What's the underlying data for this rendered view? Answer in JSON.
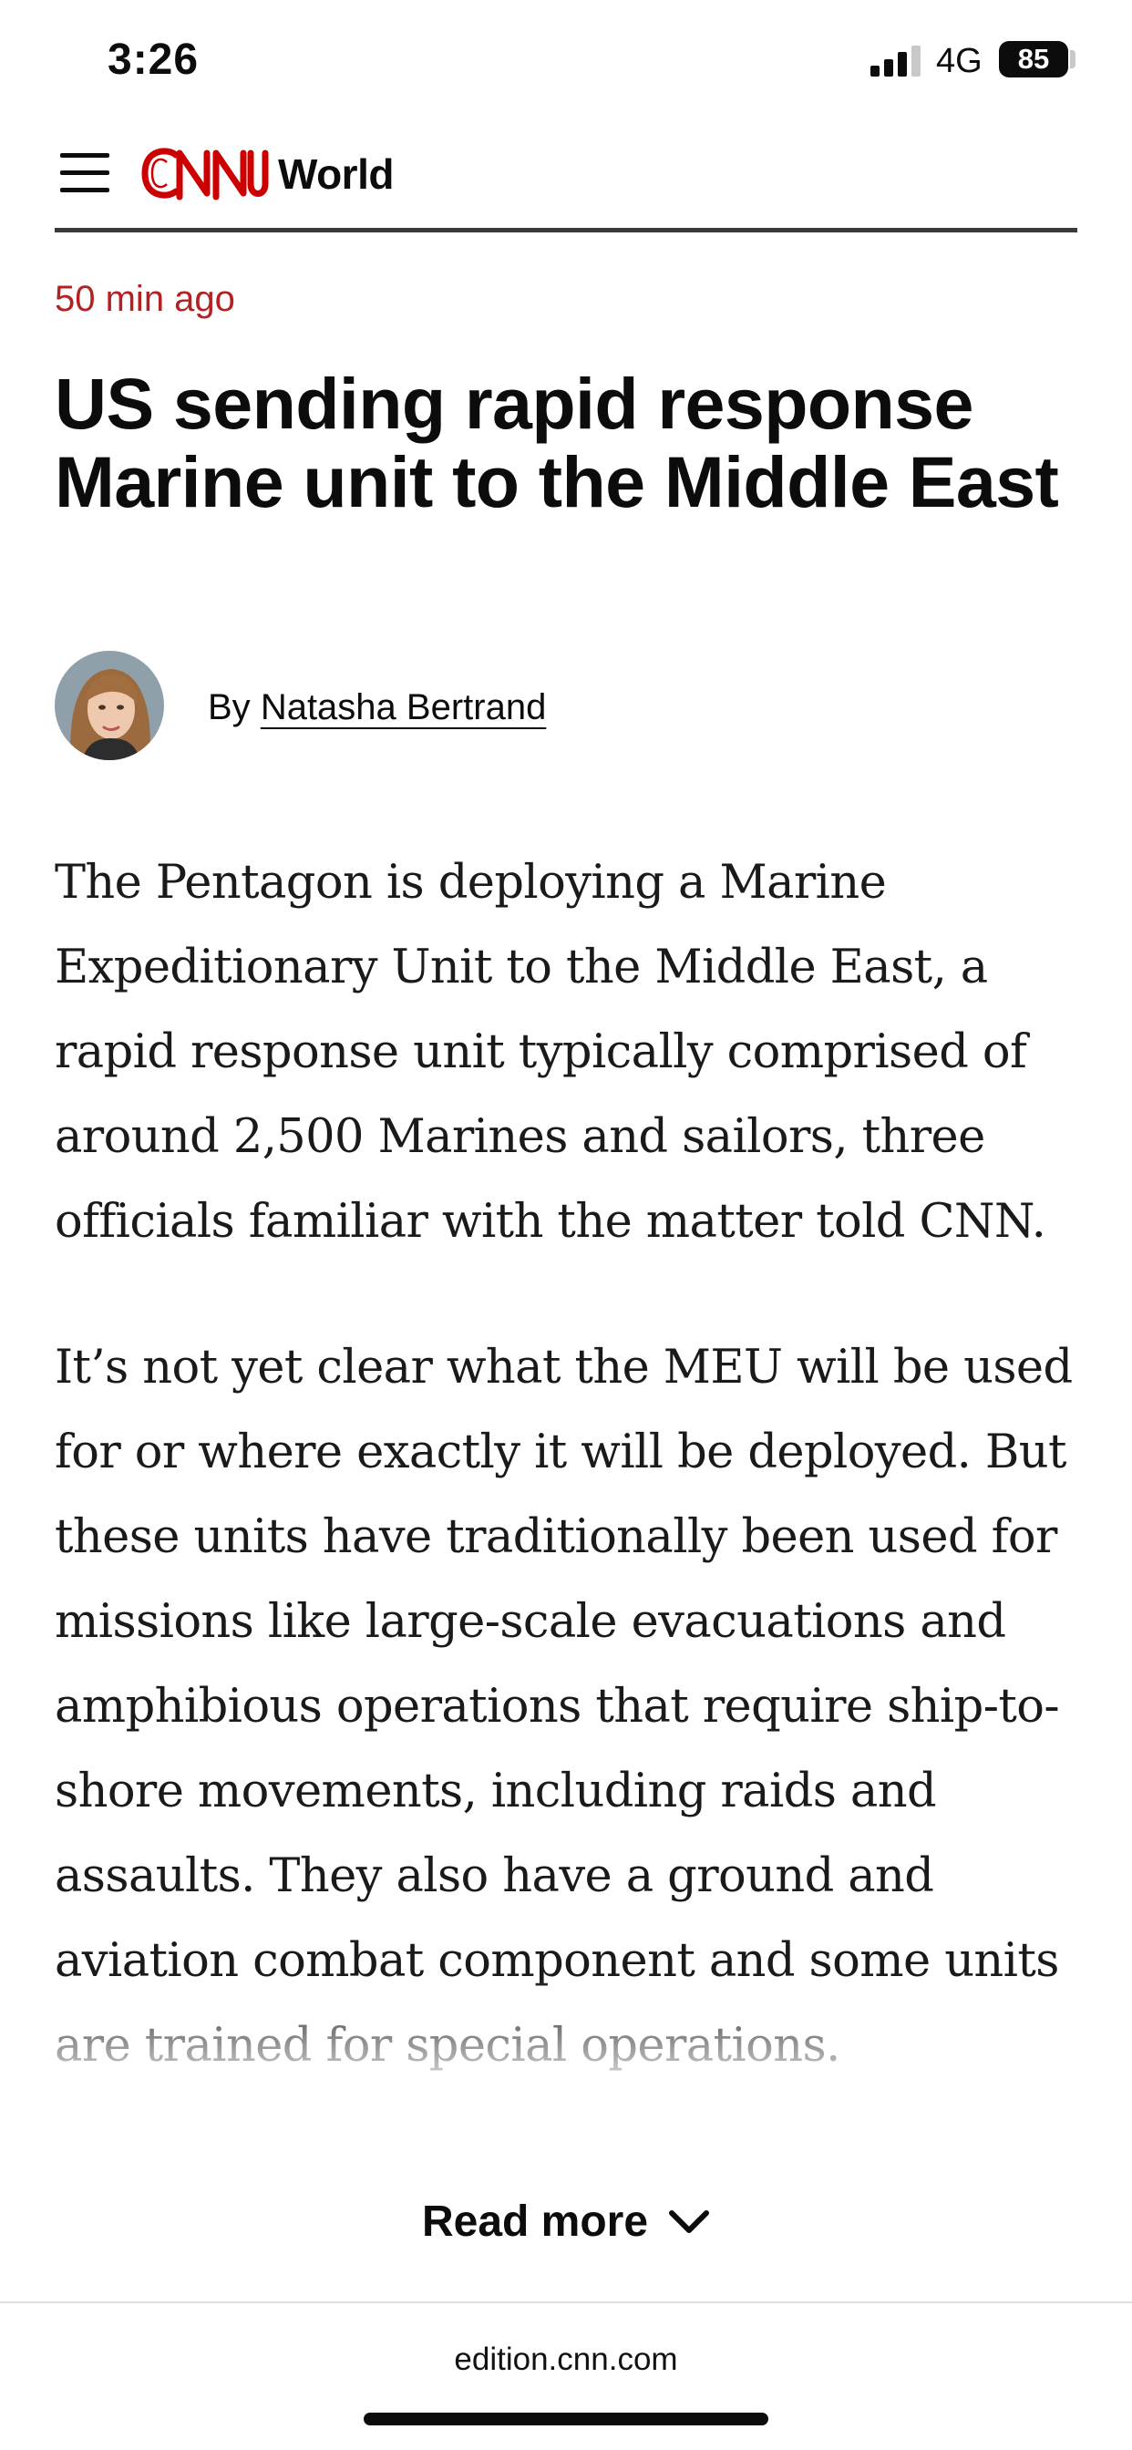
{
  "status_bar": {
    "time": "3:26",
    "network": "4G",
    "battery_level": "85",
    "signal_icon": "cellular-signal-icon",
    "battery_icon": "battery-icon"
  },
  "header": {
    "menu_icon": "hamburger-menu-icon",
    "logo_text": "CNN",
    "section": "World",
    "brand_color": "#cc0000"
  },
  "article": {
    "timestamp": "50 min ago",
    "headline": "US sending rapid response Marine unit to the Middle East",
    "byline_prefix": "By",
    "author": "Natasha Bertrand",
    "paragraphs": [
      "The Pentagon is deploying a Marine Expeditionary Unit to the Middle East, a rapid response unit typically comprised of around 2,500 Marines and sailors, three officials familiar with the matter told CNN.",
      "It’s not yet clear what the MEU will be used for or where exactly it will be deployed. But these units have traditionally been used for missions like large-scale evacuations and amphibious operations that require ship-to-shore movements, including raids and assaults. They also have a ground and aviation combat component and some units are trained for special operations."
    ],
    "read_more_label": "Read more",
    "timestamp_color": "#b22222"
  },
  "browser": {
    "url": "edition.cnn.com"
  }
}
